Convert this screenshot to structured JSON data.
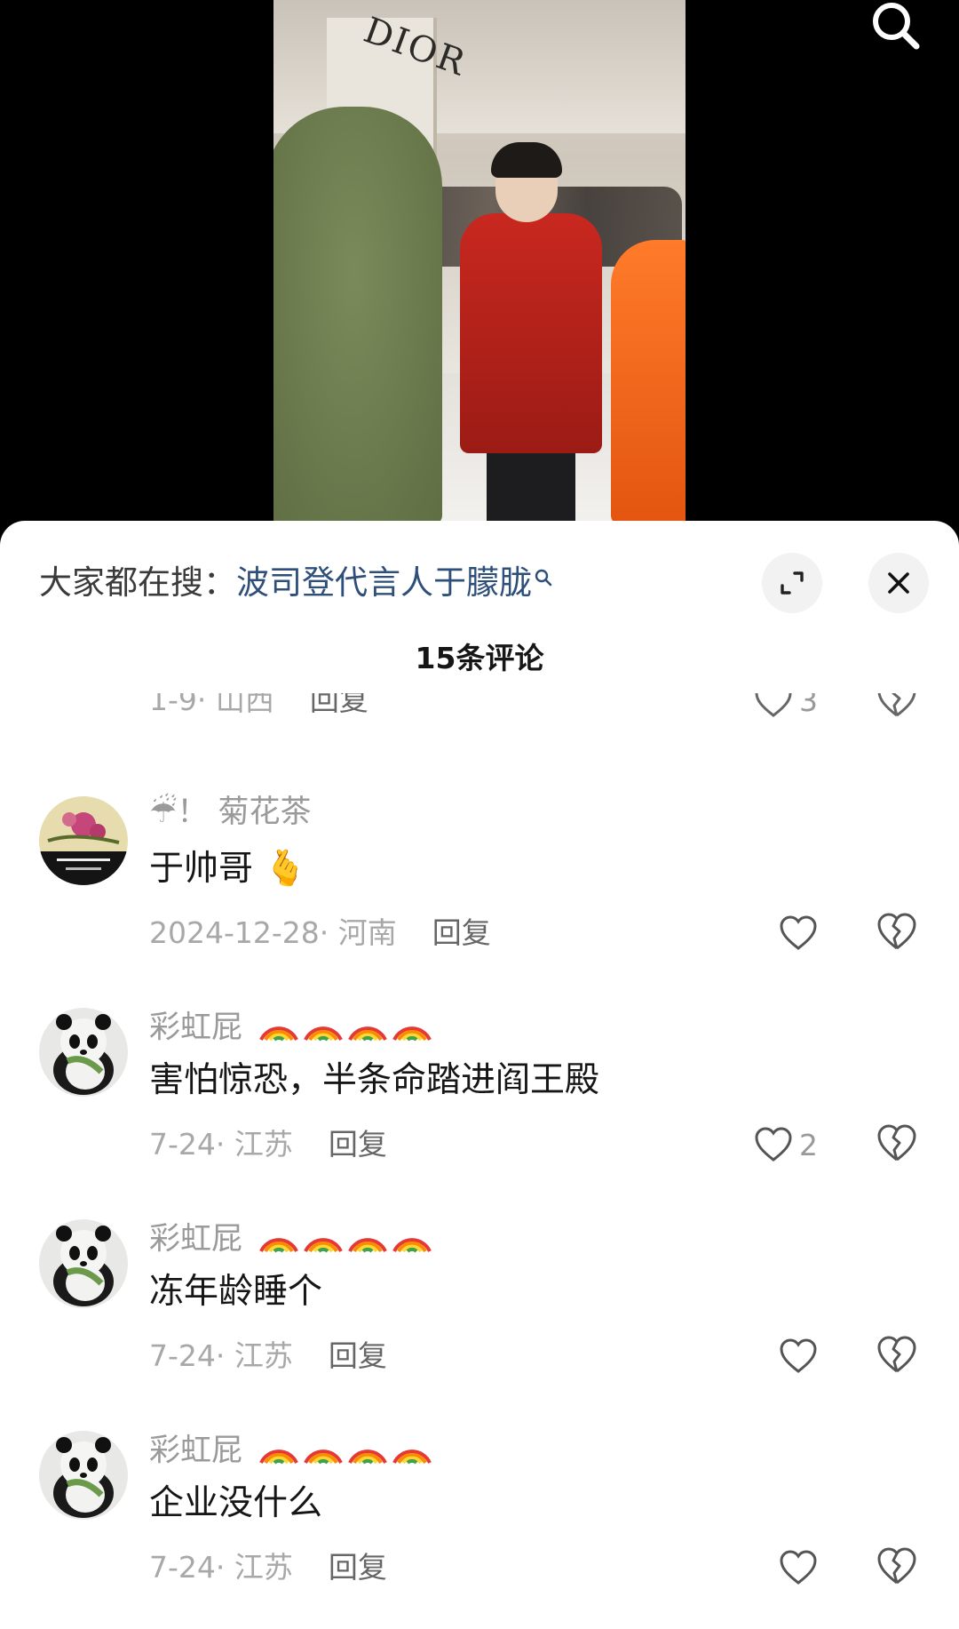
{
  "video": {
    "store_sign": "DIOR"
  },
  "sheet": {
    "search_prefix": "大家都在搜：",
    "search_query": "波司登代言人于朦胧",
    "comments_count": "15条评论"
  },
  "partial_comment": {
    "meta": "1-9· 山西",
    "reply_label": "回复",
    "likes": "3"
  },
  "comments": [
    {
      "username": "☔！ 菊花茶",
      "text": "于帅哥 🫰",
      "meta": "2024-12-28· 河南",
      "reply_label": "回复",
      "likes": ""
    },
    {
      "username": "彩虹屁",
      "text": "害怕惊恐，半条命踏进阎王殿",
      "meta": "7-24· 江苏",
      "reply_label": "回复",
      "likes": "2"
    },
    {
      "username": "彩虹屁",
      "text": "冻年龄睡个",
      "meta": "7-24· 江苏",
      "reply_label": "回复",
      "likes": ""
    },
    {
      "username": "彩虹屁",
      "text": "企业没什么",
      "meta": "7-24· 江苏",
      "reply_label": "回复",
      "likes": ""
    }
  ],
  "colors": {
    "search_query": "#2e4f7a",
    "meta_gray": "#a8a8a8",
    "text_dark": "#161616"
  },
  "icons": {
    "search": "search-icon",
    "expand": "expand-icon",
    "close": "close-icon",
    "like": "heart-outline-icon",
    "dislike": "broken-heart-icon",
    "rainbow": "rainbow-emoji"
  }
}
